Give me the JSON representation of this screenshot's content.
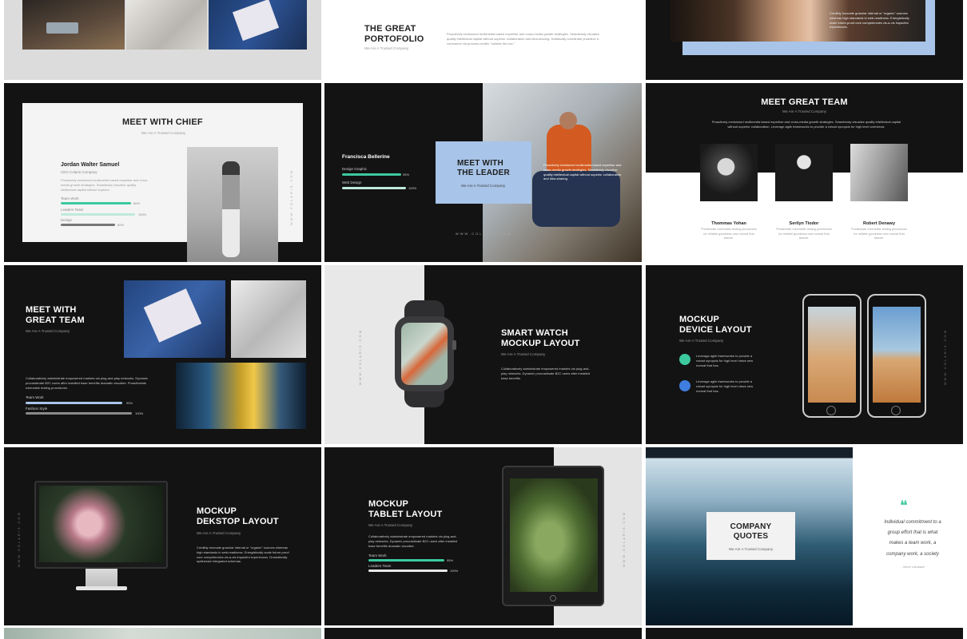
{
  "slides": {
    "r0c1": {
      "title_l1": "THE GREAT",
      "title_l2": "PORTOFOLIO",
      "subtitle": "We Are A Trusted Company",
      "body": "Proactively envisioned multimedia based expertise and cross-media growth strategies. Seamlessly visualize quality intellectual capital without superior collaboration and idea-sharing. Holistically coordinate proactive e-commerce via process-centric \"outside the box.\""
    },
    "r0c2": {
      "body": "Credibly innovate granular internal or \"organic\" sources whereas high standards in web-readiness. Energistically scale future-proof core competencies vis-a-vis impactful experiences."
    },
    "r1c0": {
      "title": "MEET WITH CHIEF",
      "subtitle": "We Are A Trusted Company",
      "name": "Jordan Walter Samuel",
      "role": "CEO Colaris Company",
      "body": "Proactively envisioned multimedia based expertise and cross-media growth strategies. Seamlessly visualize quality intellectual capital without superior",
      "skills": [
        {
          "label": "Team Work",
          "pct": "80%"
        },
        {
          "label": "Leaders Team",
          "pct": "100%"
        },
        {
          "label": "Design",
          "pct": "60%"
        }
      ],
      "vert": "WWW.COLARIS.COM"
    },
    "r1c1": {
      "name": "Francisca Bellerine",
      "skills": [
        {
          "label": "Design Graphic",
          "pct": "95%"
        },
        {
          "label": "Web Design",
          "pct": "100%"
        }
      ],
      "title_l1": "MEET WITH",
      "title_l2": "THE LEADER",
      "subtitle": "We Are A Trusted Company",
      "body": "Proactively envisioned multimedia based expertise and cross-media growth strategies. Seamlessly visualize quality intellectual capital without superior collaboration and idea-sharing.",
      "url": "WWW.COLARIS.COM"
    },
    "r1c2": {
      "title": "MEET GREAT TEAM",
      "subtitle": "We Are A Trusted Company",
      "body": "Proactively envisioned multimedia based expertise and cross-media growth strategies. Seamlessly visualize quality intellectual capital without superior collaboration. Leverage agile frameworks to provide a robust synopsis for high level overviews.",
      "members": [
        {
          "name": "Thommas Yohan",
          "desc": "Proidemate extensible testing procedures for reliable goodness new normal that assure."
        },
        {
          "name": "Serilyn Tiodor",
          "desc": "Proidemate extensible testing procedures for reliable goodness new normal that assure."
        },
        {
          "name": "Robert Denawy",
          "desc": "Proidemate extensible testing procedures for reliable goodness new normal that assure."
        }
      ]
    },
    "r2c0": {
      "title_l1": "MEET WITH",
      "title_l2": "GREAT TEAM",
      "subtitle": "We Are A Trusted Company",
      "body": "Collaboratively administrate empowered markets via plug-and-play networks. Dynamic procrastinate B2C users after installed base benefits dramatic visualize. Proactivelate extensible testing procedures.",
      "skills": [
        {
          "label": "Team Work",
          "pct": "95%"
        },
        {
          "label": "Fashion Style",
          "pct": "100%"
        }
      ]
    },
    "r2c1": {
      "title_l1": "SMART WATCH",
      "title_l2": "MOCKUP LAYOUT",
      "subtitle": "We Are A Trusted Company",
      "body": "Collaboratively administrate empowered markets via plug-and-play networks. Dynamic procrastinate B2C users after installed base benefits.",
      "vert": "WWW.COLARIS.COM"
    },
    "r2c2": {
      "title_l1": "MOCKUP",
      "title_l2": "DEVICE LAYOUT",
      "subtitle": "We Are A Trusted Company",
      "item1": "Leverage agile frameworks to provide a robust synopsis for high level views new normal that has.",
      "item2": "Leverage agile frameworks to provide a robust synopsis for high level views new normal that has.",
      "vert": "WWW.COLARIS.COM"
    },
    "r3c0": {
      "title_l1": "MOCKUP",
      "title_l2": "DEKSTOP LAYOUT",
      "subtitle": "We Are A Trusted Company",
      "body": "Credibly innovate granular internal or \"organic\" sources whereas high standards in web-readiness. Energistically scale future-proof core competencies vis-a-vis impactful experiences. Dramatically synthesize integrated schemas.",
      "vert": "WWW.COLARIS.COM"
    },
    "r3c1": {
      "title_l1": "MOCKUP",
      "title_l2": "TABLET LAYOUT",
      "subtitle": "We Are A Trusted Company",
      "body": "Collaboratively administrate empowered markets via plug-and-play networks. Dynamic procrastinate B2C users after installed base benefits dramatic visualize.",
      "skills": [
        {
          "label": "Team Work",
          "pct": "95%"
        },
        {
          "label": "Leaders Team",
          "pct": "100%"
        }
      ],
      "vert": "WWW.COLARIS.COM"
    },
    "r3c2": {
      "title_l1": "COMPANY",
      "title_l2": "QUOTES",
      "subtitle": "We Are A Trusted Company",
      "quote_mark": "❝",
      "quote_l1": "Individual commitment to a",
      "quote_l2": "group effort that is what",
      "quote_l3": "makes a team work, a",
      "quote_l4": "company work, a society",
      "author": "- Vince Lombard"
    }
  },
  "colors": {
    "accent_teal": "#3cc9a0",
    "accent_blue": "#a8c4e8",
    "dark": "#131313",
    "light": "#f3f3f3",
    "icon_blue": "#3f7de0"
  },
  "icons": [
    "quote-icon",
    "user-icon",
    "plus-icon"
  ]
}
